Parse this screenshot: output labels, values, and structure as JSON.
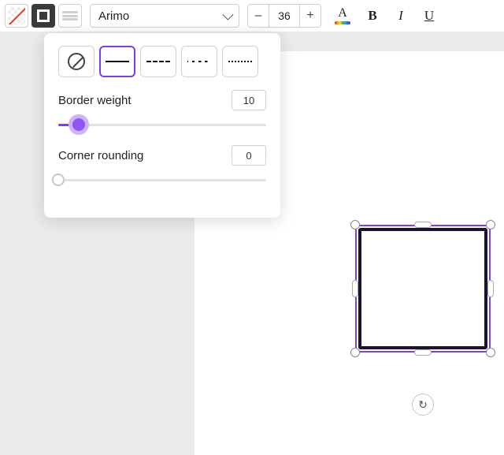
{
  "toolbar": {
    "font_name": "Arimo",
    "font_size": "36",
    "minus": "–",
    "plus": "+",
    "text_color_letter": "A",
    "bold": "B",
    "italic": "I",
    "underline": "U"
  },
  "panel": {
    "border_weight_label": "Border weight",
    "border_weight_value": "10",
    "corner_rounding_label": "Corner rounding",
    "corner_rounding_value": "0"
  },
  "colors": {
    "accent": "#7b3ff2"
  },
  "shape": {
    "border_width": 10,
    "corner_radius": 0
  }
}
